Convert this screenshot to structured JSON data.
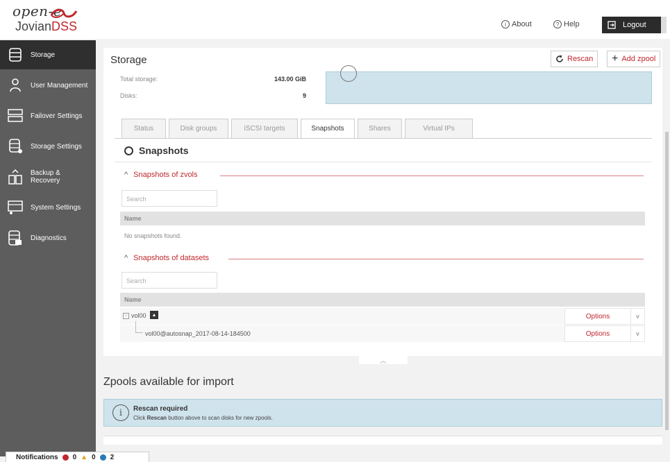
{
  "logo": {
    "top": "open-e",
    "bottom_a": "Jovian",
    "bottom_b": "DSS"
  },
  "topbar": {
    "about": "About",
    "help": "Help",
    "logout": "Logout"
  },
  "sidebar": {
    "items": [
      {
        "label": "Storage",
        "icon": "storage-icon",
        "active": true
      },
      {
        "label": "User Management",
        "icon": "users-icon"
      },
      {
        "label": "Failover Settings",
        "icon": "failover-icon"
      },
      {
        "label": "Storage Settings",
        "icon": "storage-settings-icon"
      },
      {
        "label": "Backup & Recovery",
        "icon": "backup-icon"
      },
      {
        "label": "System Settings",
        "icon": "system-settings-icon"
      },
      {
        "label": "Diagnostics",
        "icon": "diagnostics-icon"
      }
    ]
  },
  "header": {
    "title": "Storage",
    "rescan": "Rescan",
    "add_zpool": "Add zpool"
  },
  "summary": {
    "total_storage_label": "Total storage:",
    "total_storage_value": "143.00 GiB",
    "disks_label": "Disks:",
    "disks_value": "9"
  },
  "tabs": [
    {
      "label": "Status"
    },
    {
      "label": "Disk groups"
    },
    {
      "label": "iSCSI targets"
    },
    {
      "label": "Snapshots",
      "active": true
    },
    {
      "label": "Shares"
    },
    {
      "label": "Virtual IPs"
    }
  ],
  "snapshots": {
    "title": "Snapshots",
    "zvols": {
      "heading": "Snapshots of zvols",
      "search_placeholder": "Search",
      "col_name": "Name",
      "empty": "No snapshots found."
    },
    "datasets": {
      "heading": "Snapshots of datasets",
      "search_placeholder": "Search",
      "col_name": "Name",
      "rows": [
        {
          "name": "vol00",
          "options": "Options"
        },
        {
          "name": "vol00@autosnap_2017-08-14-184500",
          "options": "Options"
        }
      ]
    }
  },
  "zpools_import": {
    "title": "Zpools available for import",
    "notice_title": "Rescan required",
    "notice_pre": "Click ",
    "notice_bold": "Rescan",
    "notice_post": " button above to scan disks for new zpools."
  },
  "notifications": {
    "label": "Notifications",
    "errors": "0",
    "warnings": "0",
    "info": "2"
  },
  "colors": {
    "accent": "#c0272d",
    "sidebar": "#5d5d5d",
    "info_bg": "#cfe3ec"
  }
}
